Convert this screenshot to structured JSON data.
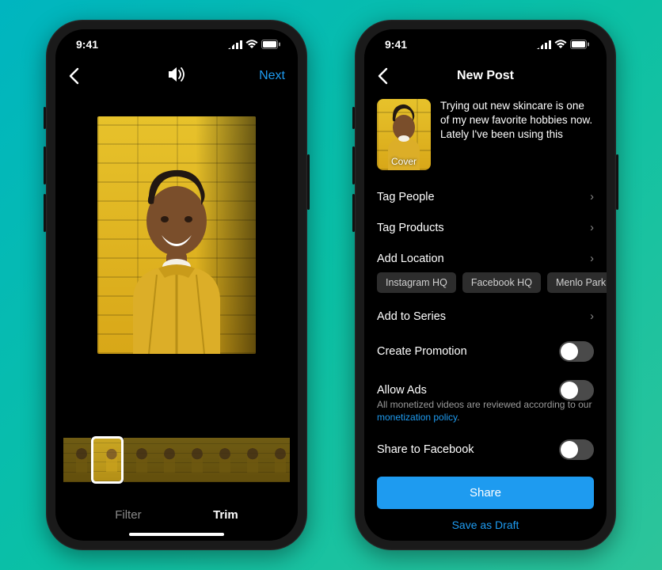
{
  "status": {
    "time": "9:41"
  },
  "left": {
    "nav": {
      "next": "Next"
    },
    "tabs": {
      "filter": "Filter",
      "trim": "Trim",
      "active": "trim"
    }
  },
  "right": {
    "nav": {
      "title": "New Post"
    },
    "caption": "Trying out new skincare is one of my new favorite hobbies now. Lately I've been using this",
    "cover_label": "Cover",
    "rows": {
      "tag_people": "Tag People",
      "tag_products": "Tag Products",
      "add_location": "Add Location",
      "add_to_series": "Add to Series",
      "create_promotion": "Create Promotion",
      "allow_ads": "Allow Ads",
      "share_facebook": "Share to Facebook"
    },
    "location_chips": [
      "Instagram HQ",
      "Facebook HQ",
      "Menlo Park, CA"
    ],
    "allow_ads_note": "All monetized videos are reviewed according to our ",
    "allow_ads_link": "monetization policy",
    "buttons": {
      "share": "Share",
      "save_draft": "Save as Draft"
    }
  }
}
